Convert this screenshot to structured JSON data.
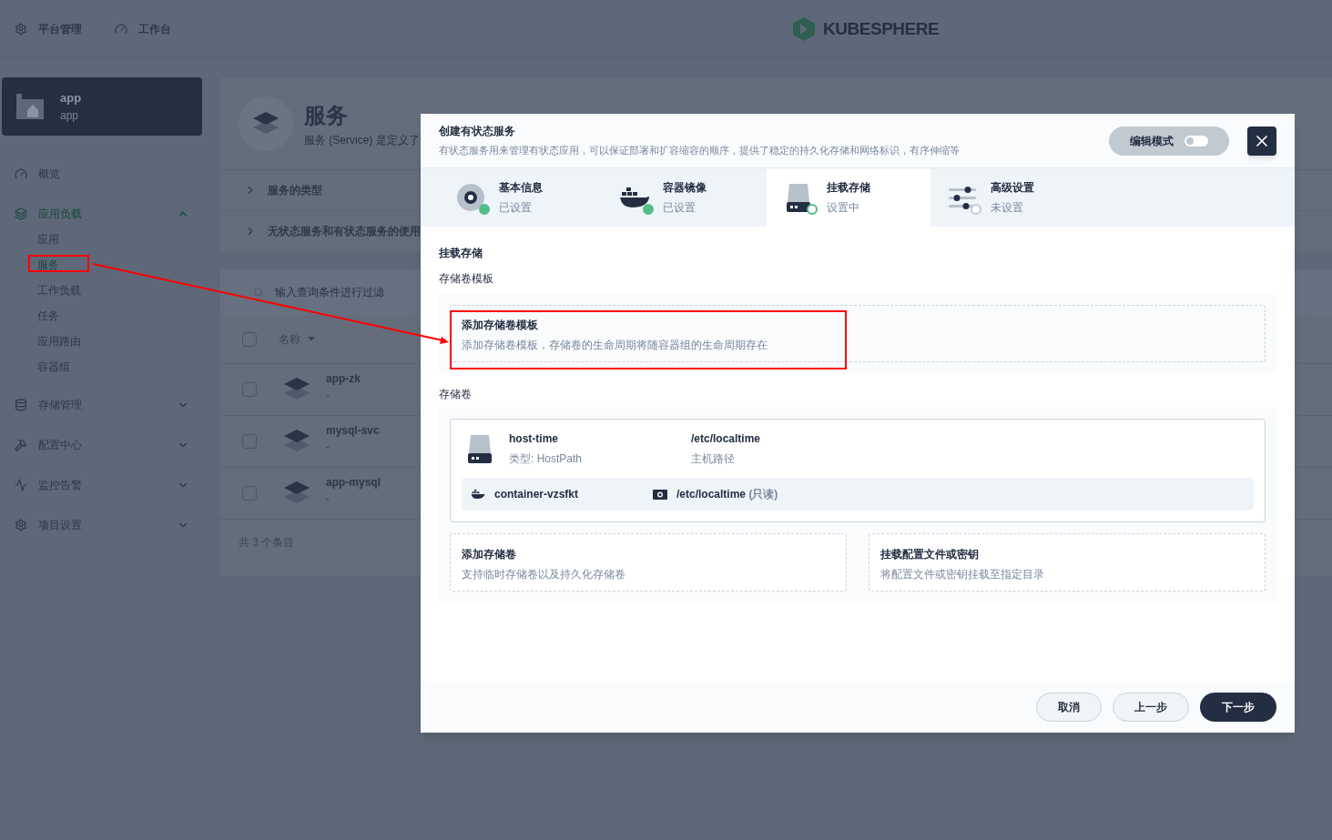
{
  "top_nav": [
    {
      "label": "平台管理",
      "kind": "gear"
    },
    {
      "label": "工作台",
      "kind": "gauge"
    }
  ],
  "logo": "KUBESPHERE",
  "project": {
    "name": "app",
    "subtitle": "app"
  },
  "sidebar": {
    "items": [
      {
        "label": "概览",
        "kind": "gauge",
        "selected": false
      },
      {
        "label": "应用负载",
        "kind": "layers",
        "selected": true,
        "expanded": true,
        "children": [
          {
            "label": "应用",
            "selected": false
          },
          {
            "label": "服务",
            "selected": true
          },
          {
            "label": "工作负载",
            "selected": false
          },
          {
            "label": "任务",
            "selected": false
          },
          {
            "label": "应用路由",
            "selected": false
          },
          {
            "label": "容器组",
            "selected": false
          }
        ]
      },
      {
        "label": "存储管理",
        "kind": "database",
        "selected": false,
        "expanded": false
      },
      {
        "label": "配置中心",
        "kind": "hammer",
        "selected": false,
        "expanded": false
      },
      {
        "label": "监控告警",
        "kind": "monitor",
        "selected": false,
        "expanded": false
      },
      {
        "label": "项目设置",
        "kind": "gear",
        "selected": false,
        "expanded": false
      }
    ]
  },
  "page": {
    "title": "服务",
    "description": "服务 (Service) 是定义了",
    "accordions": [
      "服务的类型",
      "无状态服务和有状态服务的使用"
    ],
    "search": {
      "placeholder": "输入查询条件进行过滤"
    },
    "table": {
      "columns": [
        "名称"
      ],
      "select_all": {
        "checked": false
      },
      "rows": [
        {
          "name": "app-zk",
          "description": "-",
          "checked": false
        },
        {
          "name": "mysql-svc",
          "description": "-",
          "checked": false
        },
        {
          "name": "app-mysql",
          "description": "-",
          "checked": false
        }
      ]
    },
    "footer": "共 3 个条目"
  },
  "modal": {
    "title": "创建有状态服务",
    "description": "有状态服务用来管理有状态应用，可以保证部署和扩容缩容的顺序，提供了稳定的持久化存储和网络标识，有序伸缩等",
    "edit_mode": {
      "label": "编辑模式",
      "on": false
    },
    "steps": [
      {
        "kind": "disc",
        "title": "基本信息",
        "status": "已设置",
        "done": true,
        "selected": false
      },
      {
        "kind": "whale",
        "title": "容器镜像",
        "status": "已设置",
        "done": true,
        "selected": false
      },
      {
        "kind": "drive",
        "title": "挂载存储",
        "status": "设置中",
        "done": false,
        "selected": true
      },
      {
        "kind": "sliders",
        "title": "高级设置",
        "status": "未设置",
        "done": false,
        "selected": false
      }
    ],
    "section_title": "挂载存储",
    "template_label": "存储卷模板",
    "template_card": {
      "title": "添加存储卷模板",
      "description": "添加存储卷模板，存储卷的生命周期将随容器组的生命周期存在"
    },
    "volumes_label": "存储卷",
    "volume": {
      "name": "host-time",
      "type": "类型: HostPath",
      "path": "/etc/localtime",
      "path_label": "主机路径",
      "mount": {
        "container": "container-vzsfkt",
        "path": "/etc/localtime",
        "mode": "(只读)"
      }
    },
    "action_cards": [
      {
        "title": "添加存储卷",
        "description": "支持临时存储卷以及持久化存储卷"
      },
      {
        "title": "挂载配置文件或密钥",
        "description": "将配置文件或密钥挂载至指定目录"
      }
    ],
    "buttons": [
      {
        "label": "取消",
        "kind": "secondary"
      },
      {
        "label": "上一步",
        "kind": "secondary"
      },
      {
        "label": "下一步",
        "kind": "primary"
      }
    ]
  }
}
